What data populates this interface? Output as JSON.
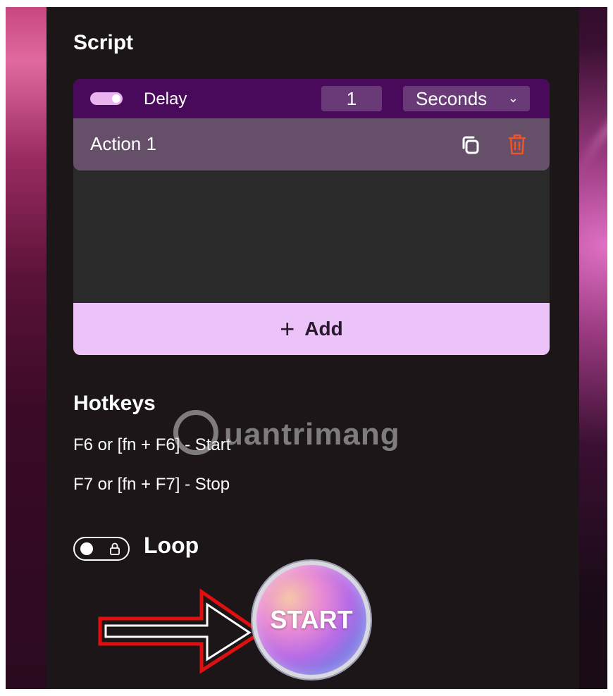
{
  "script": {
    "title": "Script",
    "delay": {
      "label": "Delay",
      "enabled": true,
      "value": "1",
      "unit": "Seconds"
    },
    "actions": [
      {
        "label": "Action 1"
      }
    ],
    "add_label": "Add"
  },
  "hotkeys": {
    "title": "Hotkeys",
    "start_line": "F6 or [fn + F6] - Start",
    "stop_line": "F7 or [fn + F7] - Stop"
  },
  "loop": {
    "label": "Loop",
    "enabled": false
  },
  "start_button": {
    "label": "START"
  },
  "watermark": {
    "text": "uantrimang"
  },
  "icons": {
    "copy": "copy-icon",
    "delete": "trash-icon",
    "add": "plus-icon",
    "chevron": "chevron-down-icon",
    "lock": "lock-icon",
    "annotation": "arrow-annotation"
  },
  "colors": {
    "panel_bg": "#1c1619",
    "delay_bar": "#4a0a5c",
    "action_row": "#664f68",
    "add_bar": "#ebc3f9",
    "trash": "#e8562a",
    "arrow": "#e01010"
  }
}
